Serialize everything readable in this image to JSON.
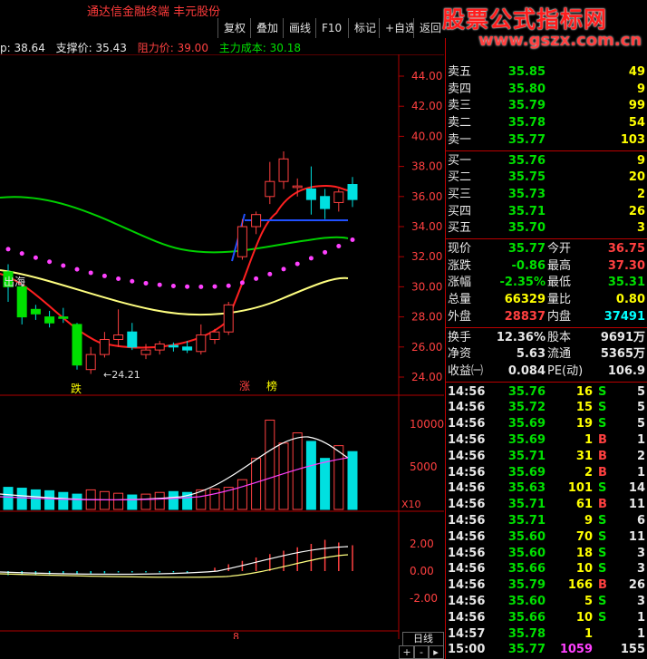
{
  "app": {
    "title": "通达信金融终端    丰元股份",
    "watermark_text": "股票公式指标网",
    "watermark_url": "www.gszx.com.cn"
  },
  "toolbar": {
    "buttons": [
      "复权",
      "叠加",
      "画线",
      "F10",
      "标记",
      "+自选",
      "返回"
    ]
  },
  "indicator_line": {
    "pressure": "p: 38.64",
    "support_label": "支撑价:",
    "support_value": "35.43",
    "resistance_label": "阻力价:",
    "resistance_value": "39.00",
    "cost_label": "主力成本:",
    "cost_value": "30.18"
  },
  "price_axis": [
    "44.00",
    "42.00",
    "40.00",
    "38.00",
    "36.00",
    "34.00",
    "32.00",
    "30.00",
    "28.00",
    "26.00",
    "24.00"
  ],
  "volume_axis": [
    "10000",
    "5000"
  ],
  "volume_unit": "X10",
  "macd_axis": [
    "2.00",
    "0.00",
    "-2.00"
  ],
  "chart_labels": {
    "low_marker": "←24.21",
    "out_sea": "出海",
    "die": "跌",
    "zhang": "涨",
    "bang": "榜",
    "bottom_tick": "8",
    "period": "日线"
  },
  "chart_data": {
    "type": "candlestick",
    "ylim": [
      24,
      44
    ],
    "candles": [
      {
        "o": 31.0,
        "h": 31.5,
        "c": 30.0,
        "l": 29.0
      },
      {
        "o": 30.0,
        "h": 30.2,
        "c": 28.0,
        "l": 27.5
      },
      {
        "o": 28.5,
        "h": 28.8,
        "c": 28.2,
        "l": 27.8
      },
      {
        "o": 28.0,
        "h": 28.4,
        "c": 27.6,
        "l": 27.3
      },
      {
        "o": 28.0,
        "h": 28.6,
        "c": 27.9,
        "l": 27.6
      },
      {
        "o": 27.5,
        "h": 27.6,
        "c": 24.8,
        "l": 24.5
      },
      {
        "o": 24.5,
        "h": 26.0,
        "c": 25.5,
        "l": 24.21
      },
      {
        "o": 25.5,
        "h": 27.0,
        "c": 26.5,
        "l": 25.3
      },
      {
        "o": 26.5,
        "h": 28.5,
        "c": 26.8,
        "l": 26.0
      },
      {
        "o": 27.0,
        "h": 27.6,
        "c": 26.0,
        "l": 25.8
      },
      {
        "o": 25.5,
        "h": 26.2,
        "c": 25.8,
        "l": 25.2
      },
      {
        "o": 25.8,
        "h": 26.4,
        "c": 26.2,
        "l": 25.5
      },
      {
        "o": 26.1,
        "h": 26.3,
        "c": 26.0,
        "l": 25.7
      },
      {
        "o": 26.0,
        "h": 26.4,
        "c": 25.8,
        "l": 25.6
      },
      {
        "o": 25.7,
        "h": 27.5,
        "c": 26.8,
        "l": 25.5
      },
      {
        "o": 26.5,
        "h": 27.2,
        "c": 27.0,
        "l": 26.2
      },
      {
        "o": 27.0,
        "h": 29.0,
        "c": 28.8,
        "l": 26.8
      },
      {
        "o": 32.0,
        "h": 34.5,
        "c": 34.0,
        "l": 31.8
      },
      {
        "o": 34.0,
        "h": 35.0,
        "c": 34.8,
        "l": 33.5
      },
      {
        "o": 36.0,
        "h": 38.3,
        "c": 37.0,
        "l": 35.5
      },
      {
        "o": 37.0,
        "h": 39.0,
        "c": 38.5,
        "l": 36.5
      },
      {
        "o": 36.6,
        "h": 37.2,
        "c": 36.7,
        "l": 36.0
      },
      {
        "o": 36.5,
        "h": 38.0,
        "c": 35.8,
        "l": 34.8
      },
      {
        "o": 36.0,
        "h": 36.5,
        "c": 35.2,
        "l": 34.5
      },
      {
        "o": 35.6,
        "h": 36.5,
        "c": 36.3,
        "l": 35.0
      },
      {
        "o": 36.8,
        "h": 37.3,
        "c": 35.8,
        "l": 35.3
      }
    ],
    "volume": [
      2600,
      2500,
      2300,
      2200,
      2000,
      1800,
      2300,
      2100,
      1900,
      1700,
      1800,
      2000,
      2100,
      2000,
      2300,
      2400,
      2600,
      3500,
      6000,
      10500,
      7800,
      9000,
      8000,
      6000,
      7500,
      6800
    ],
    "volume_ylim": [
      0,
      13000
    ],
    "macd_ylim": [
      -3,
      3
    ]
  },
  "quotes": {
    "ask": [
      {
        "label": "卖五",
        "price": "35.85",
        "vol": "49"
      },
      {
        "label": "卖四",
        "price": "35.80",
        "vol": "9"
      },
      {
        "label": "卖三",
        "price": "35.79",
        "vol": "99"
      },
      {
        "label": "卖二",
        "price": "35.78",
        "vol": "54"
      },
      {
        "label": "卖一",
        "price": "35.77",
        "vol": "103"
      }
    ],
    "bid": [
      {
        "label": "买一",
        "price": "35.76",
        "vol": "9"
      },
      {
        "label": "买二",
        "price": "35.75",
        "vol": "20"
      },
      {
        "label": "买三",
        "price": "35.73",
        "vol": "2"
      },
      {
        "label": "买四",
        "price": "35.71",
        "vol": "26"
      },
      {
        "label": "买五",
        "price": "35.70",
        "vol": "3"
      }
    ],
    "stats": [
      {
        "l1": "现价",
        "v1": "35.77",
        "l2": "今开",
        "v2": "36.75"
      },
      {
        "l1": "涨跌",
        "v1": "-0.86",
        "l2": "最高",
        "v2": "37.30"
      },
      {
        "l1": "涨幅",
        "v1": "-2.35%",
        "l2": "最低",
        "v2": "35.31"
      },
      {
        "l1": "总量",
        "v1": "66329",
        "l2": "量比",
        "v2": "0.80"
      },
      {
        "l1": "外盘",
        "v1": "28837",
        "l2": "内盘",
        "v2": "37491"
      }
    ],
    "stats2": [
      {
        "l1": "换手",
        "v1": "12.36%",
        "l2": "股本",
        "v2": "9691万"
      },
      {
        "l1": "净资",
        "v1": "5.63",
        "l2": "流通",
        "v2": "5365万"
      },
      {
        "l1": "收益㈠",
        "v1": "0.084",
        "l2": "PE(动)",
        "v2": "106.9"
      }
    ],
    "ticks": [
      {
        "t": "14:56",
        "p": "35.76",
        "v": "16",
        "s": "S",
        "n": "5"
      },
      {
        "t": "14:56",
        "p": "35.72",
        "v": "15",
        "s": "S",
        "n": "5"
      },
      {
        "t": "14:56",
        "p": "35.69",
        "v": "19",
        "s": "S",
        "n": "5"
      },
      {
        "t": "14:56",
        "p": "35.69",
        "v": "1",
        "s": "B",
        "n": "1"
      },
      {
        "t": "14:56",
        "p": "35.71",
        "v": "31",
        "s": "B",
        "n": "2"
      },
      {
        "t": "14:56",
        "p": "35.69",
        "v": "2",
        "s": "B",
        "n": "1"
      },
      {
        "t": "14:56",
        "p": "35.63",
        "v": "101",
        "s": "S",
        "n": "14"
      },
      {
        "t": "14:56",
        "p": "35.71",
        "v": "61",
        "s": "B",
        "n": "11"
      },
      {
        "t": "14:56",
        "p": "35.71",
        "v": "9",
        "s": "S",
        "n": "6"
      },
      {
        "t": "14:56",
        "p": "35.60",
        "v": "70",
        "s": "S",
        "n": "11"
      },
      {
        "t": "14:56",
        "p": "35.60",
        "v": "18",
        "s": "S",
        "n": "3"
      },
      {
        "t": "14:56",
        "p": "35.66",
        "v": "10",
        "s": "S",
        "n": "3"
      },
      {
        "t": "14:56",
        "p": "35.79",
        "v": "166",
        "s": "B",
        "n": "26"
      },
      {
        "t": "14:56",
        "p": "35.60",
        "v": "5",
        "s": "S",
        "n": "3"
      },
      {
        "t": "14:56",
        "p": "35.66",
        "v": "10",
        "s": "S",
        "n": "1"
      },
      {
        "t": "14:57",
        "p": "35.78",
        "v": "1",
        "s": "",
        "n": "1"
      },
      {
        "t": "15:00",
        "p": "35.77",
        "v": "1059",
        "s": "",
        "n": "155"
      }
    ]
  },
  "colors": {
    "up": "#ff4040",
    "down": "#00e0e0",
    "green_bar": "#00e000",
    "grid": "#b00000"
  }
}
